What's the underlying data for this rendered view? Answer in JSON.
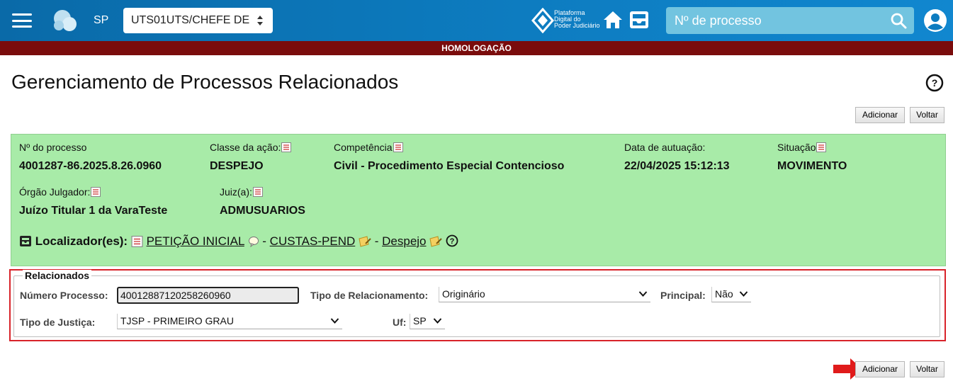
{
  "header": {
    "state": "SP",
    "unit_select": "UTS01UTS/CHEFE DE",
    "platform_logo_lines": [
      "Plataforma",
      "Digital do",
      "Poder Judiciário"
    ],
    "search_placeholder": "Nº de processo",
    "brand_color": "#0d7cc0"
  },
  "env_banner": {
    "text": "HOMOLOGAÇÃO",
    "color": "#7a0c0c"
  },
  "page": {
    "title": "Gerenciamento de Processos Relacionados",
    "add_label": "Adicionar",
    "back_label": "Voltar"
  },
  "process": {
    "background": "#a8eba8",
    "numero_label": "Nº do processo",
    "numero_value": "4001287-86.2025.8.26.0960",
    "classe_label": "Classe da ação:",
    "classe_value": "DESPEJO",
    "competencia_label": "Competência",
    "competencia_value": "Civil - Procedimento Especial Contencioso",
    "data_label": "Data de autuação:",
    "data_value": "22/04/2025 15:12:13",
    "situacao_label": "Situação",
    "situacao_value": "MOVIMENTO",
    "orgao_label": "Órgão Julgador:",
    "orgao_value": "Juízo Titular 1 da VaraTeste",
    "juiz_label": "Juiz(a):",
    "juiz_value": "ADMUSUARIOS",
    "localizadores_label": "Localizador(es):",
    "localizadores": [
      "PETIÇÃO INICIAL",
      "CUSTAS-PEND",
      "Despejo"
    ],
    "separator": "-"
  },
  "relacionados": {
    "legend": "Relacionados",
    "numero_label": "Número Processo:",
    "numero_value": "40012887120258260960",
    "tipo_rel_label": "Tipo de Relacionamento:",
    "tipo_rel_value": "Originário",
    "principal_label": "Principal:",
    "principal_value": "Não",
    "tipo_justica_label": "Tipo de Justiça:",
    "tipo_justica_value": "TJSP - PRIMEIRO GRAU",
    "uf_label": "Uf:",
    "uf_value": "SP",
    "highlight_color": "#d8232a"
  }
}
